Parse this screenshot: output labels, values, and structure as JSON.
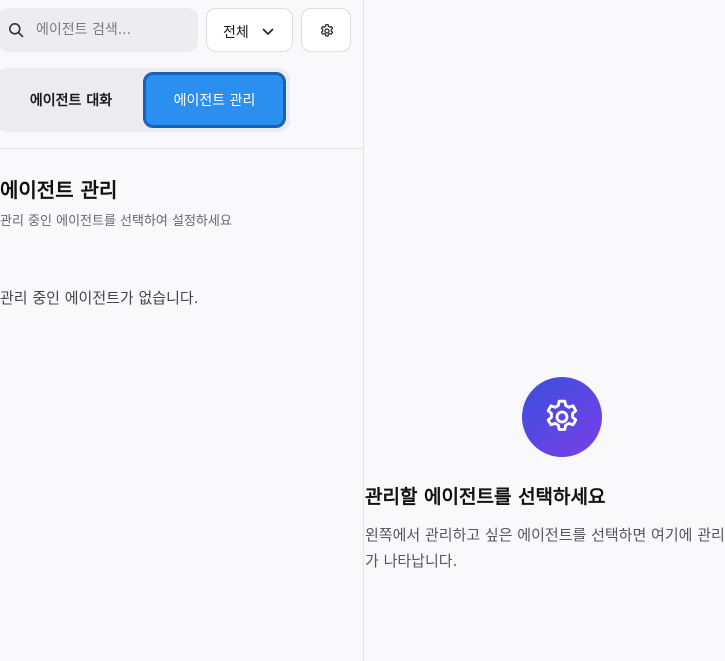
{
  "search": {
    "placeholder": "에이전트 검색..."
  },
  "filter": {
    "selected": "전체"
  },
  "tabs": [
    {
      "label": "에이전트 대화",
      "active": false
    },
    {
      "label": "에이전트 관리",
      "active": true
    }
  ],
  "section": {
    "title": "에이전트 관리",
    "subtitle": "관리 중인 에이전트를 선택하여 설정하세요",
    "empty_message": "관리 중인 에이전트가 없습니다."
  },
  "detail": {
    "title": "관리할 에이전트를 선택하세요",
    "description": "왼쪽에서 관리하고 싶은 에이전트를 선택하면 여기에 관리 인터페이스가 나타납니다."
  },
  "icons": {
    "search": "search-icon",
    "chevron": "chevron-down-icon",
    "settings": "gear-icon",
    "hero": "gear-icon"
  },
  "colors": {
    "accent": "#2b8ff0",
    "hero_gradient_start": "#3b4fe0",
    "hero_gradient_end": "#7a3fe6"
  }
}
